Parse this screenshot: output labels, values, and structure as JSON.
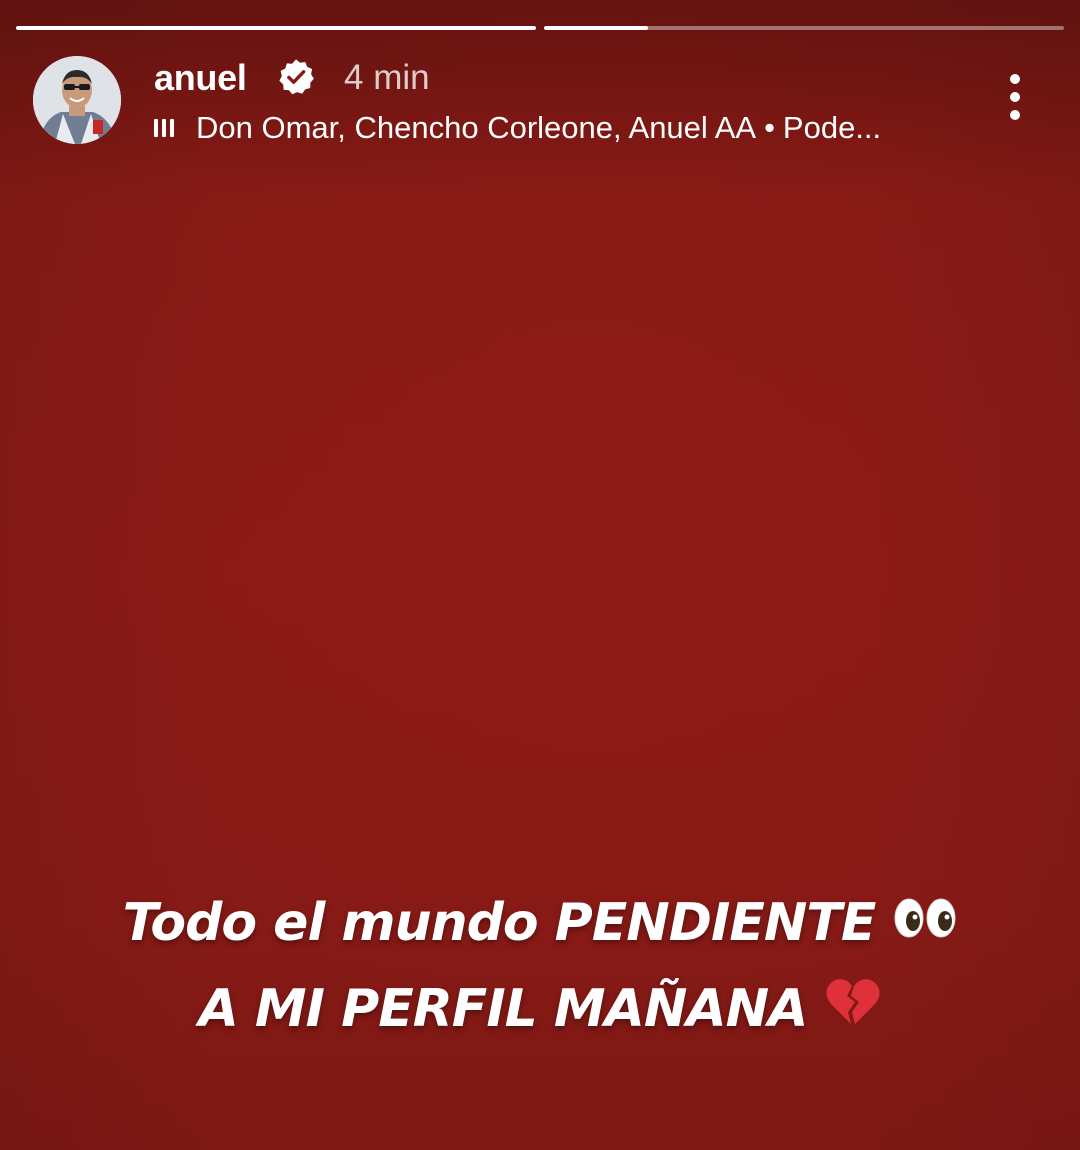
{
  "story": {
    "progress": [
      1.0,
      0.2
    ],
    "user": {
      "username": "anuel",
      "verified": true,
      "time_ago": "4 min"
    },
    "music": {
      "artists": "Don Omar, Chencho Corleone, Anuel AA",
      "separator": "•",
      "song_truncated": "Pode..."
    },
    "caption": {
      "line1": "Todo el mundo PENDIENTE",
      "line1_emoji": "eyes-icon",
      "line2": "A MI PERFIL MAÑANA",
      "line2_emoji": "broken-heart-icon"
    },
    "colors": {
      "background": "#8a1a16",
      "text": "#ffffff",
      "broken_heart": "#e0303a"
    }
  }
}
